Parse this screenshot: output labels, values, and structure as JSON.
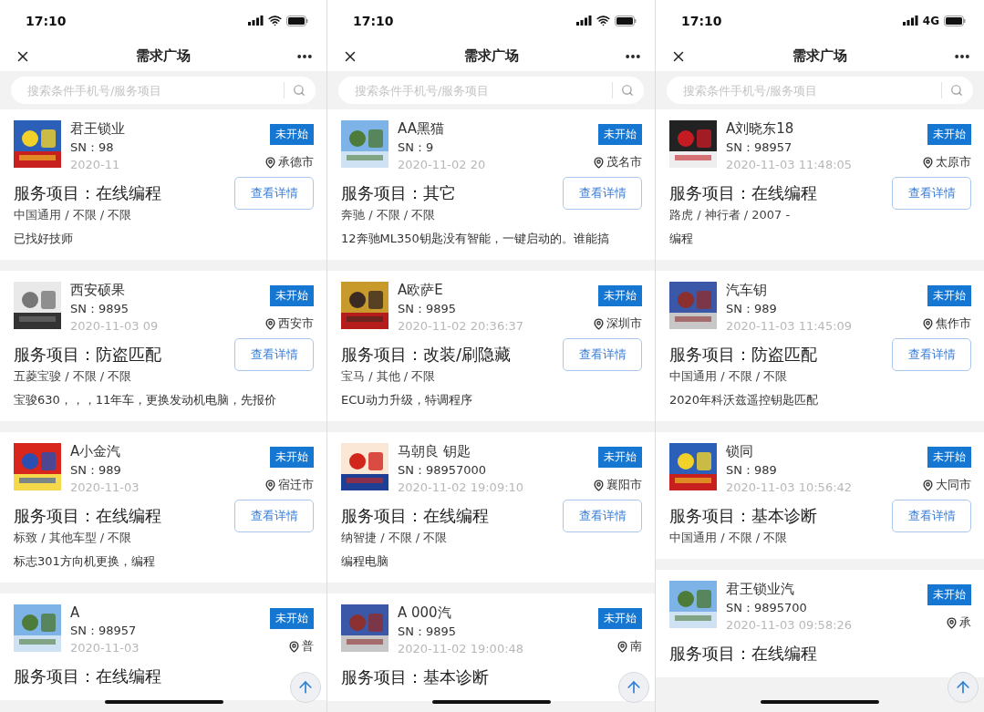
{
  "phones": [
    {
      "status_bar": {
        "time": "17:10",
        "network": {
          "kind": "wifi"
        }
      },
      "nav": {
        "title": "需求广场"
      },
      "search": {
        "placeholder": "搜索条件手机号/服务项目"
      },
      "cards": [
        {
          "name": "君王锁业",
          "sn": "SN：98",
          "time": "2020-11",
          "status": "未开始",
          "city": "承德市",
          "service": "服务项目：在线编程",
          "spec": "中国通用 / 不限 / 不限",
          "desc": "已找好技师",
          "button": "查看详情"
        },
        {
          "name": "西安硕果",
          "sn": "SN：9895",
          "time": "2020-11-03 09",
          "status": "未开始",
          "city": "西安市",
          "service": "服务项目：防盗匹配",
          "spec": "五菱宝骏 / 不限 / 不限",
          "desc": "宝骏630，，，11年车，更换发动机电脑，先报价",
          "button": "查看详情"
        },
        {
          "name": "A小金汽",
          "sn": "SN：989",
          "time": "2020-11-03",
          "status": "未开始",
          "city": "宿迁市",
          "service": "服务项目：在线编程",
          "spec": "标致 / 其他车型 / 不限",
          "desc": "标志301方向机更换，编程",
          "button": "查看详情"
        },
        {
          "name": "A",
          "sn": "SN：98957",
          "time": "2020-11-03",
          "status": "未开始",
          "city": "普",
          "service": "服务项目：在线编程"
        }
      ]
    },
    {
      "status_bar": {
        "time": "17:10",
        "network": {
          "kind": "wifi"
        }
      },
      "nav": {
        "title": "需求广场"
      },
      "search": {
        "placeholder": "搜索条件手机号/服务项目"
      },
      "cards": [
        {
          "name": "AA黑猫",
          "sn": "SN：9",
          "time": "2020-11-02 20",
          "status": "未开始",
          "city": "茂名市",
          "service": "服务项目：其它",
          "spec": "奔驰 / 不限 / 不限",
          "desc": "12奔驰ML350钥匙没有智能，一键启动的。谁能搞",
          "button": "查看详情"
        },
        {
          "name": "A欧萨E",
          "sn": "SN：9895",
          "time": "2020-11-02 20:36:37",
          "status": "未开始",
          "city": "深圳市",
          "service": "服务项目：改装/刷隐藏",
          "spec": "宝马 / 其他 / 不限",
          "desc": "ECU动力升级，特调程序",
          "button": "查看详情"
        },
        {
          "name": "马朝良 钥匙",
          "sn": "SN：98957000",
          "time": "2020-11-02 19:09:10",
          "status": "未开始",
          "city": "襄阳市",
          "service": "服务项目：在线编程",
          "spec": "纳智捷 / 不限 / 不限",
          "desc": "编程电脑",
          "button": "查看详情"
        },
        {
          "name": "A 000汽",
          "sn": "SN：9895",
          "time": "2020-11-02 19:00:48",
          "status": "未开始",
          "city": "南",
          "service": "服务项目：基本诊断"
        }
      ]
    },
    {
      "status_bar": {
        "time": "17:10",
        "network": {
          "kind": "cellular",
          "label": "4G"
        }
      },
      "nav": {
        "title": "需求广场"
      },
      "search": {
        "placeholder": "搜索条件手机号/服务项目"
      },
      "cards": [
        {
          "name": "A刘晓东18",
          "sn": "SN：98957",
          "time": "2020-11-03 11:48:05",
          "status": "未开始",
          "city": "太原市",
          "service": "服务项目：在线编程",
          "spec": "路虎 / 神行者 / 2007 -",
          "desc": "编程",
          "button": "查看详情"
        },
        {
          "name": "汽车钥",
          "sn": "SN：989",
          "time": "2020-11-03 11:45:09",
          "status": "未开始",
          "city": "焦作市",
          "service": "服务项目：防盗匹配",
          "spec": "中国通用 / 不限 / 不限",
          "desc": "2020年科沃兹遥控钥匙匹配",
          "button": "查看详情"
        },
        {
          "name": "锁同",
          "sn": "SN：989",
          "time": "2020-11-03 10:56:42",
          "status": "未开始",
          "city": "大同市",
          "service": "服务项目：基本诊断",
          "spec": "中国通用 / 不限 / 不限",
          "button": "查看详情"
        },
        {
          "name": "君王锁业汽",
          "sn": "SN：9895700",
          "time": "2020-11-03 09:58:26",
          "status": "未开始",
          "city": "承",
          "service": "服务项目：在线编程"
        }
      ]
    }
  ]
}
